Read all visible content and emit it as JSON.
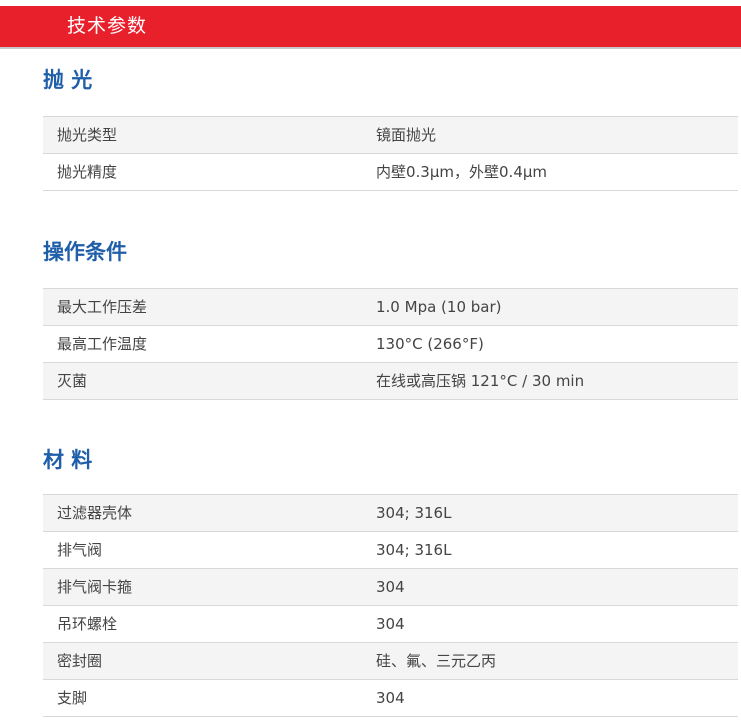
{
  "header": {
    "title": "技术参数"
  },
  "sections": [
    {
      "title": "抛 光",
      "rows": [
        {
          "label": "抛光类型",
          "value": "镜面抛光"
        },
        {
          "label": "抛光精度",
          "value": "内壁0.3μm，外壁0.4μm"
        }
      ]
    },
    {
      "title": "操作条件",
      "rows": [
        {
          "label": "最大工作压差",
          "value": "1.0 Mpa (10 bar)"
        },
        {
          "label": "最高工作温度",
          "value": "130°C (266°F)"
        },
        {
          "label": "灭菌",
          "value": "在线或高压锅 121°C / 30 min"
        }
      ]
    },
    {
      "title": "材 料",
      "rows": [
        {
          "label": "过滤器壳体",
          "value": "304; 316L"
        },
        {
          "label": "排气阀",
          "value": "304; 316L"
        },
        {
          "label": "排气阀卡箍",
          "value": "304"
        },
        {
          "label": "吊环螺栓",
          "value": "304"
        },
        {
          "label": "密封圈",
          "value": "硅、氟、三元乙丙"
        },
        {
          "label": "支脚",
          "value": "304"
        }
      ]
    }
  ]
}
